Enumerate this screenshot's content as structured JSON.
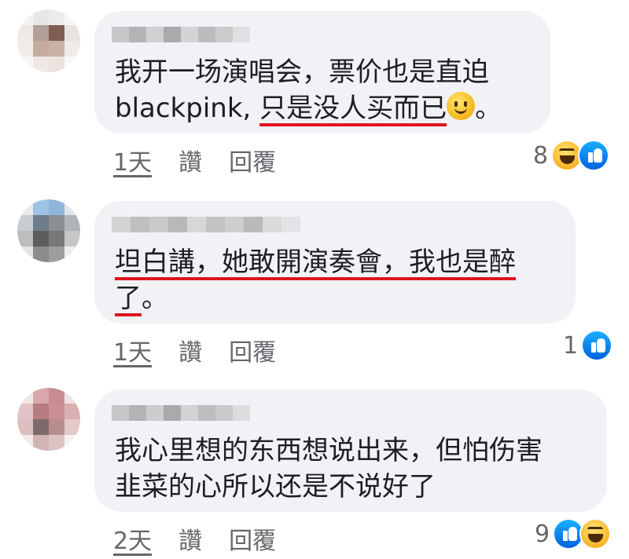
{
  "comments": [
    {
      "line1": "我开一场演唱会，票价也是直迫",
      "line2_plain": "blackpink, ",
      "line2_underlined": "只是没人买而已",
      "line2_tail": "。",
      "emoji": "slightly-smiling-face-icon",
      "time": "1天",
      "like_label": "讚",
      "reply_label": "回覆",
      "reaction_count": "8",
      "reactions": [
        "haha-icon",
        "like-icon"
      ]
    },
    {
      "line1": "坦白講，她敢開演奏會，我也是醉",
      "line2_underlined": "了",
      "line2_tail": "。",
      "time": "1天",
      "like_label": "讚",
      "reply_label": "回覆",
      "reaction_count": "1",
      "reactions": [
        "like-icon"
      ]
    },
    {
      "line1": "我心里想的东西想说出来，但怕伤害",
      "line2": "韭菜的心所以还是不说好了",
      "time": "2天",
      "like_label": "讚",
      "reply_label": "回覆",
      "reaction_count": "9",
      "reactions": [
        "like-icon",
        "haha-icon"
      ]
    }
  ],
  "colors": {
    "bubble": "#f0f2f5",
    "text": "#1c1e21",
    "meta": "#65676b",
    "underline": "#e0141e",
    "like_blue": "#1877f2"
  }
}
